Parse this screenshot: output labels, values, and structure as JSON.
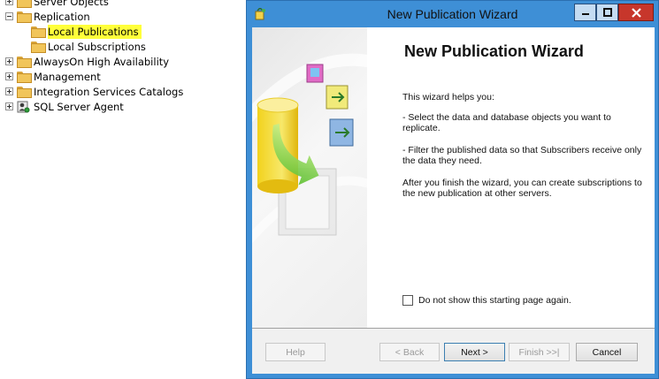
{
  "tree": {
    "items": [
      {
        "label": "Server Objects",
        "expander": "plus",
        "level": 0,
        "icon": "folder-icon"
      },
      {
        "label": "Replication",
        "expander": "minus",
        "level": 0,
        "icon": "folder-icon"
      },
      {
        "label": "Local Publications",
        "expander": "none",
        "level": 1,
        "icon": "folder-icon",
        "highlighted": true
      },
      {
        "label": "Local Subscriptions",
        "expander": "none",
        "level": 1,
        "icon": "folder-icon"
      },
      {
        "label": "AlwaysOn High Availability",
        "expander": "plus",
        "level": 0,
        "icon": "folder-icon"
      },
      {
        "label": "Management",
        "expander": "plus",
        "level": 0,
        "icon": "folder-icon"
      },
      {
        "label": "Integration Services Catalogs",
        "expander": "plus",
        "level": 0,
        "icon": "folder-icon"
      },
      {
        "label": "SQL Server Agent",
        "expander": "plus",
        "level": 0,
        "icon": "sql-agent-icon"
      }
    ]
  },
  "wizard": {
    "window_title": "New Publication Wizard",
    "heading": "New Publication Wizard",
    "intro": "This wizard helps you:",
    "bullet1": "- Select the data and database objects you want to replicate.",
    "bullet2": "- Filter the published data so that Subscribers receive only the data they need.",
    "closing": "After you finish the wizard, you can create subscriptions to the new publication at other servers.",
    "checkbox_label": "Do not show this starting page again.",
    "checkbox_checked": false,
    "buttons": {
      "help": "Help",
      "back": "< Back",
      "next": "Next >",
      "finish": "Finish >>|",
      "cancel": "Cancel"
    }
  },
  "colors": {
    "highlight": "#ffff3a",
    "window_frame": "#3e8fd6",
    "close_button": "#c7362b"
  }
}
